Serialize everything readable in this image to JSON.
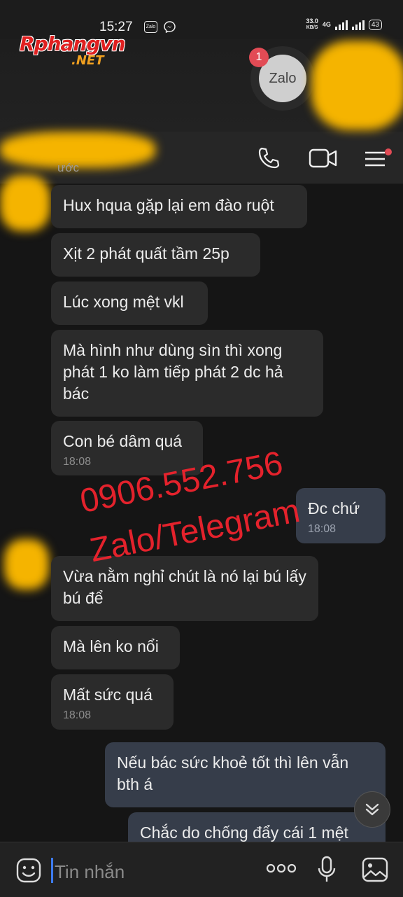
{
  "status_bar": {
    "time": "15:27",
    "app_icons": [
      "zalo-icon",
      "messenger-icon"
    ],
    "net_speed": "33.0",
    "net_unit": "KB/S",
    "network": "4G",
    "battery": "43"
  },
  "watermark_logo": {
    "brand": "Rphangvn",
    "tld": ".NET"
  },
  "zalo_bubble": {
    "label": "Zalo",
    "badge": "1"
  },
  "header": {
    "status": "ước"
  },
  "messages": [
    {
      "dir": "in",
      "text": "Hux hqua gặp lại em đào ruột"
    },
    {
      "dir": "in",
      "text": "Xịt 2 phát quất tầm 25p"
    },
    {
      "dir": "in",
      "text": "Lúc xong mệt vkl"
    },
    {
      "dir": "in",
      "text": "Mà hình như dùng sìn thì xong phát 1 ko làm tiếp phát 2 dc hả bác"
    },
    {
      "dir": "in",
      "text": "Con bé dâm quá",
      "time": "18:08"
    },
    {
      "dir": "out",
      "text": "Đc chứ",
      "time": "18:08"
    },
    {
      "dir": "in",
      "text": "Vừa nằm nghỉ chút là nó lại bú lấy bú để"
    },
    {
      "dir": "in",
      "text": "Mà lên ko nổi"
    },
    {
      "dir": "in",
      "text": "Mất sức quá",
      "time": "18:08"
    },
    {
      "dir": "out",
      "text": "Nếu bác sức khoẻ tốt thì lên vẫn bth á"
    },
    {
      "dir": "out",
      "text": "Chắc do chống đẩy cái 1 mệt"
    }
  ],
  "overlay": {
    "phone": "0906.552.756",
    "contact": "Zalo/Telegram"
  },
  "input": {
    "placeholder": "Tin nhắn"
  },
  "colors": {
    "bg": "#151515",
    "incoming": "#2b2b2b",
    "outgoing": "#363d4a",
    "accent": "#3d7bf0",
    "watermark": "#f0232e"
  }
}
